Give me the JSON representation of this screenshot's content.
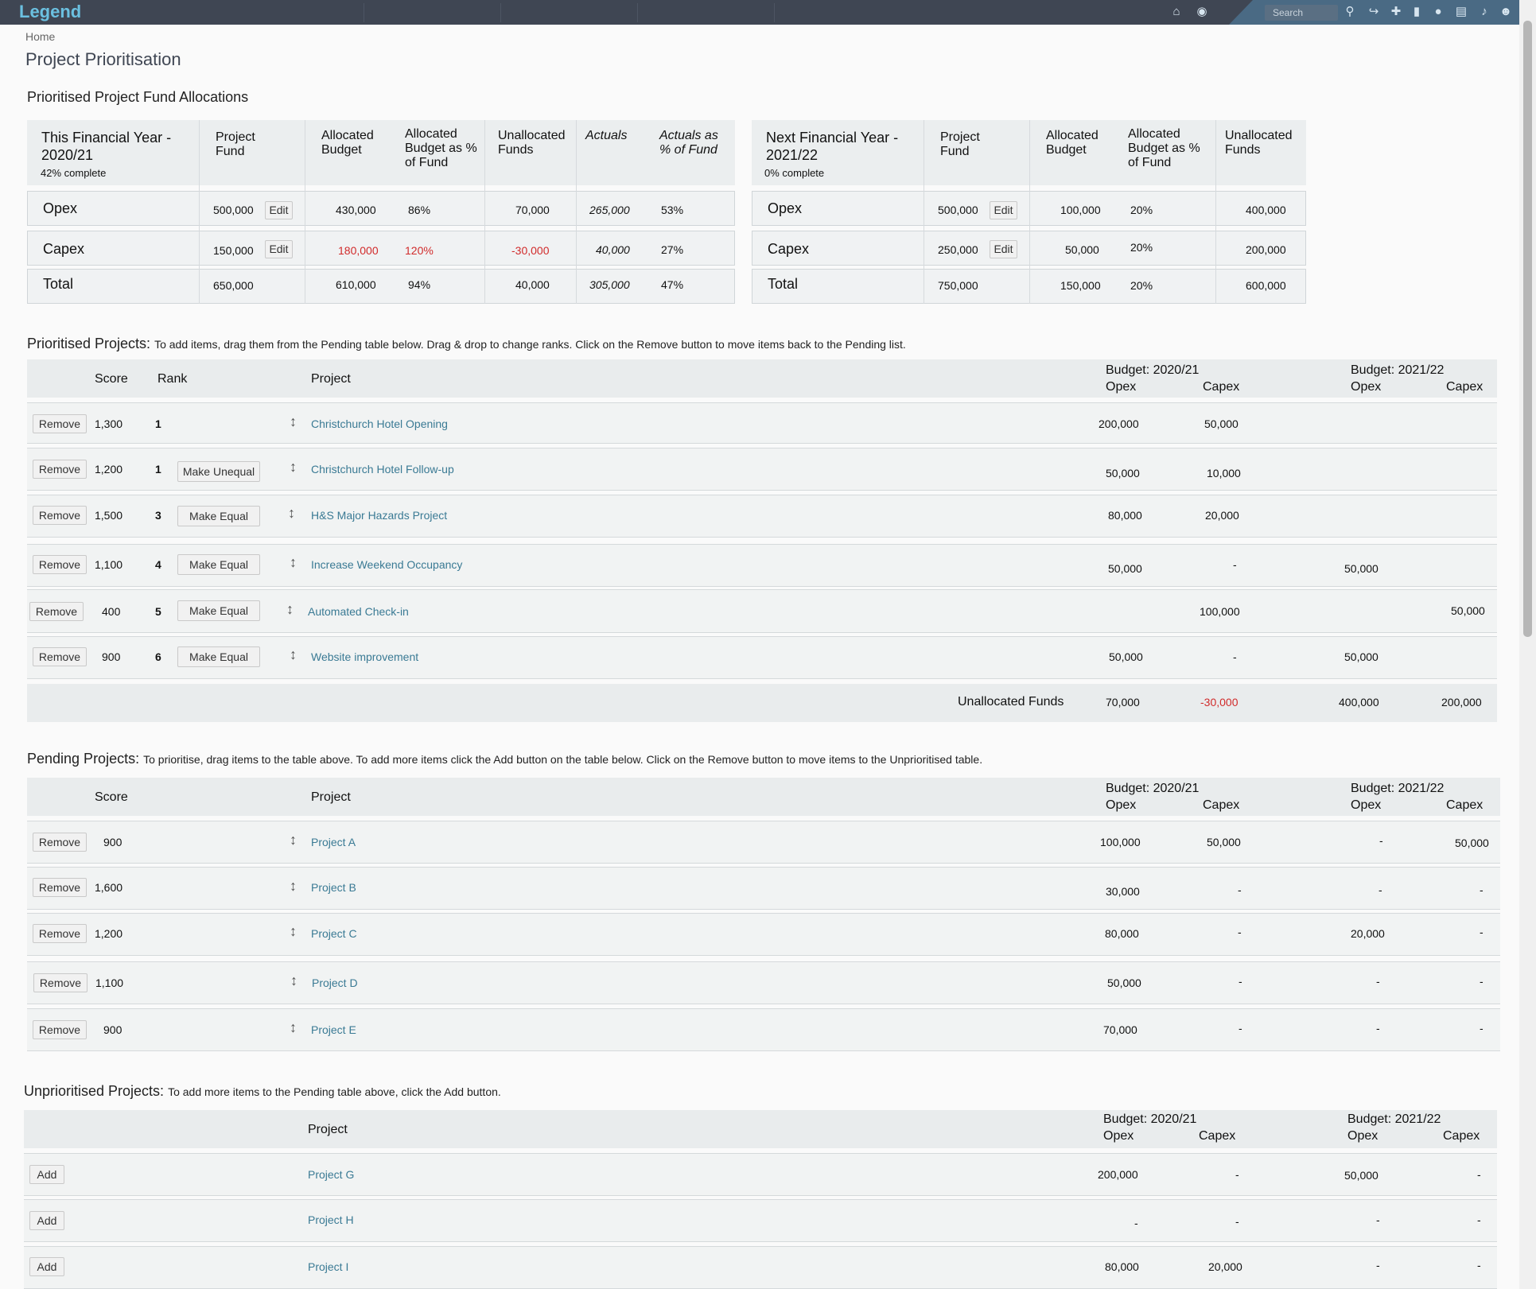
{
  "topbar": {
    "logo": "Legend",
    "search_placeholder": "Search",
    "icons": [
      "home-icon",
      "globe-icon",
      "search-icon",
      "share-icon",
      "plus-icon",
      "bookmark-icon",
      "chat-icon",
      "document-icon",
      "bell-icon",
      "user-icon"
    ]
  },
  "breadcrumb": "Home",
  "page_title": "Project Prioritisation",
  "fund_allocations": {
    "title": "Prioritised Project Fund Allocations",
    "this_year": {
      "title": "This Financial Year - 2020/21",
      "progress": "42% complete",
      "headers": {
        "fund": "Project Fund",
        "allocated": "Allocated Budget",
        "alloc_pct": "Allocated Budget as % of Fund",
        "unallocated": "Unallocated Funds",
        "actuals": "Actuals",
        "actuals_pct": "Actuals as % of  Fund"
      },
      "rows": [
        {
          "label": "Opex",
          "fund": "500,000",
          "edit": "Edit",
          "allocated": "430,000",
          "alloc_pct": "86%",
          "unallocated": "70,000",
          "actuals": "265,000",
          "actuals_pct": "53%"
        },
        {
          "label": "Capex",
          "fund": "150,000",
          "edit": "Edit",
          "allocated": "180,000",
          "alloc_pct": "120%",
          "unallocated": "-30,000",
          "actuals": "40,000",
          "actuals_pct": "27%"
        },
        {
          "label": "Total",
          "fund": "650,000",
          "allocated": "610,000",
          "alloc_pct": "94%",
          "unallocated": "40,000",
          "actuals": "305,000",
          "actuals_pct": "47%"
        }
      ]
    },
    "next_year": {
      "title": "Next Financial Year - 2021/22",
      "progress": "0% complete",
      "headers": {
        "fund": "Project Fund",
        "allocated": "Allocated Budget",
        "alloc_pct": "Allocated Budget as % of Fund",
        "unallocated": "Unallocated Funds"
      },
      "rows": [
        {
          "label": "Opex",
          "fund": "500,000",
          "edit": "Edit",
          "allocated": "100,000",
          "alloc_pct": "20%",
          "unallocated": "400,000"
        },
        {
          "label": "Capex",
          "fund": "250,000",
          "edit": "Edit",
          "allocated": "50,000",
          "alloc_pct": "20%",
          "unallocated": "200,000"
        },
        {
          "label": "Total",
          "fund": "750,000",
          "allocated": "150,000",
          "alloc_pct": "20%",
          "unallocated": "600,000"
        }
      ]
    }
  },
  "prioritised": {
    "title": "Prioritised Projects:",
    "instructions": "To add items, drag them from the Pending table below. Drag & drop to change ranks. Click on the Remove button to move items back to the Pending list.",
    "headers": {
      "score": "Score",
      "rank": "Rank",
      "project": "Project",
      "budget1": "Budget: 2020/21",
      "budget2": "Budget: 2021/22",
      "opex": "Opex",
      "capex": "Capex"
    },
    "rows": [
      {
        "btn": "Remove",
        "score": "1,300",
        "rank": "1",
        "equal": "",
        "project": "Christchurch Hotel Opening",
        "o1": "200,000",
        "c1": "50,000",
        "o2": "",
        "c2": ""
      },
      {
        "btn": "Remove",
        "score": "1,200",
        "rank": "1",
        "equal": "Make Unequal",
        "project": "Christchurch Hotel Follow-up",
        "o1": "50,000",
        "c1": "10,000",
        "o2": "",
        "c2": ""
      },
      {
        "btn": "Remove",
        "score": "1,500",
        "rank": "3",
        "equal": "Make Equal",
        "project": "H&S Major Hazards Project",
        "o1": "80,000",
        "c1": "20,000",
        "o2": "",
        "c2": ""
      },
      {
        "btn": "Remove",
        "score": "1,100",
        "rank": "4",
        "equal": "Make Equal",
        "project": "Increase Weekend Occupancy",
        "o1": "50,000",
        "c1": "-",
        "o2": "50,000",
        "c2": ""
      },
      {
        "btn": "Remove",
        "score": "400",
        "rank": "5",
        "equal": "Make Equal",
        "project": "Automated Check-in",
        "o1": "",
        "c1": "100,000",
        "o2": "",
        "c2": "50,000"
      },
      {
        "btn": "Remove",
        "score": "900",
        "rank": "6",
        "equal": "Make Equal",
        "project": "Website improvement",
        "o1": "50,000",
        "c1": "-",
        "o2": "50,000",
        "c2": ""
      }
    ],
    "footer": {
      "label": "Unallocated Funds",
      "o1": "70,000",
      "c1": "-30,000",
      "o2": "400,000",
      "c2": "200,000"
    }
  },
  "pending": {
    "title": "Pending Projects:",
    "instructions": "To prioritise, drag items to the table above. To  add more items click the Add button on the table below. Click on the Remove button to move items to the Unprioritised table.",
    "rows": [
      {
        "btn": "Remove",
        "score": "900",
        "project": "Project A",
        "o1": "100,000",
        "c1": "50,000",
        "o2": "-",
        "c2": "50,000"
      },
      {
        "btn": "Remove",
        "score": "1,600",
        "project": "Project B",
        "o1": "30,000",
        "c1": "-",
        "o2": "-",
        "c2": "-"
      },
      {
        "btn": "Remove",
        "score": "1,200",
        "project": "Project C",
        "o1": "80,000",
        "c1": "-",
        "o2": "20,000",
        "c2": "-"
      },
      {
        "btn": "Remove",
        "score": "1,100",
        "project": "Project D",
        "o1": "50,000",
        "c1": "-",
        "o2": "-",
        "c2": "-"
      },
      {
        "btn": "Remove",
        "score": "900",
        "project": "Project E",
        "o1": "70,000",
        "c1": "-",
        "o2": "-",
        "c2": "-"
      }
    ]
  },
  "unprioritised": {
    "title": "Unprioritised Projects:",
    "instructions": "To  add more items to the Pending table above,  click the Add button.",
    "rows": [
      {
        "btn": "Add",
        "project": "Project G",
        "o1": "200,000",
        "c1": "-",
        "o2": "50,000",
        "c2": "-"
      },
      {
        "btn": "Add",
        "project": "Project H",
        "o1": "-",
        "c1": "-",
        "o2": "-",
        "c2": "-"
      },
      {
        "btn": "Add",
        "project": "Project I",
        "o1": "80,000",
        "c1": "20,000",
        "o2": "-",
        "c2": "-"
      }
    ]
  }
}
